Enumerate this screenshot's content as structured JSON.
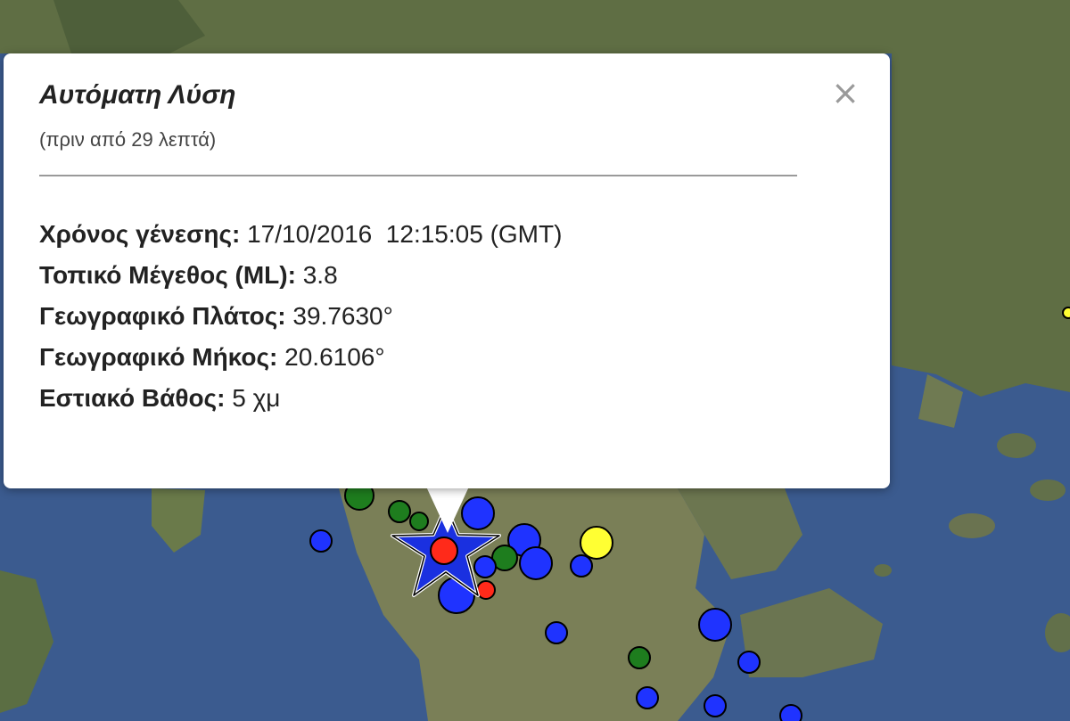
{
  "popup": {
    "title": "Αυτόματη Λύση",
    "subtitle": "(πριν από 29 λεπτά)",
    "close_label": "×",
    "rows": [
      {
        "label": "Χρόνος γένεσης:",
        "value": "17/10/2016  12:15:05 (GMT)"
      },
      {
        "label": "Τοπικό Μέγεθος (ML):",
        "value": "3.8"
      },
      {
        "label": "Γεωγραφικό Πλάτος:",
        "value": "39.7630°"
      },
      {
        "label": "Γεωγραφικό Μήκος:",
        "value": "20.6106°"
      },
      {
        "label": "Εστιακό Βάθος:",
        "value": "5 χμ"
      }
    ]
  },
  "map": {
    "colors": {
      "sea": "#3b5b8f",
      "land": "#6f7e4f",
      "marker_blue": "#1f33ff",
      "marker_green": "#1e7d1e",
      "marker_red": "#ff2a1a",
      "marker_yellow": "#ffff33",
      "epicenter_star": "#1a30e0"
    },
    "epicenter_icon": "star-icon"
  }
}
